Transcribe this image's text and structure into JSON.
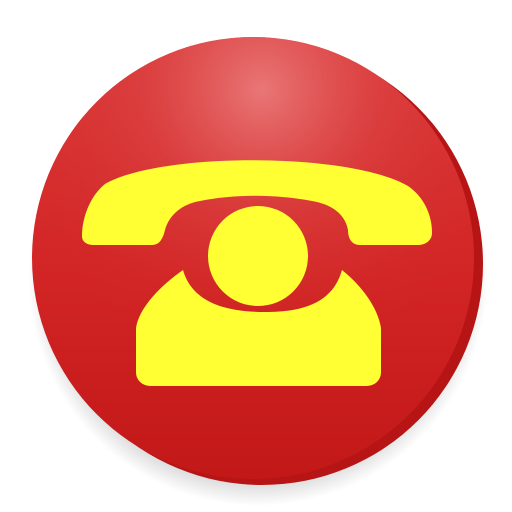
{
  "icon": {
    "name": "telephone-app-icon",
    "glyph": "rotary-telephone-icon",
    "colors": {
      "background": "#ffffff",
      "button_base": "#d52a2a",
      "button_edge": "#b81414",
      "button_highlight": "#e86f6f",
      "phone_body": "#ffff33"
    }
  }
}
